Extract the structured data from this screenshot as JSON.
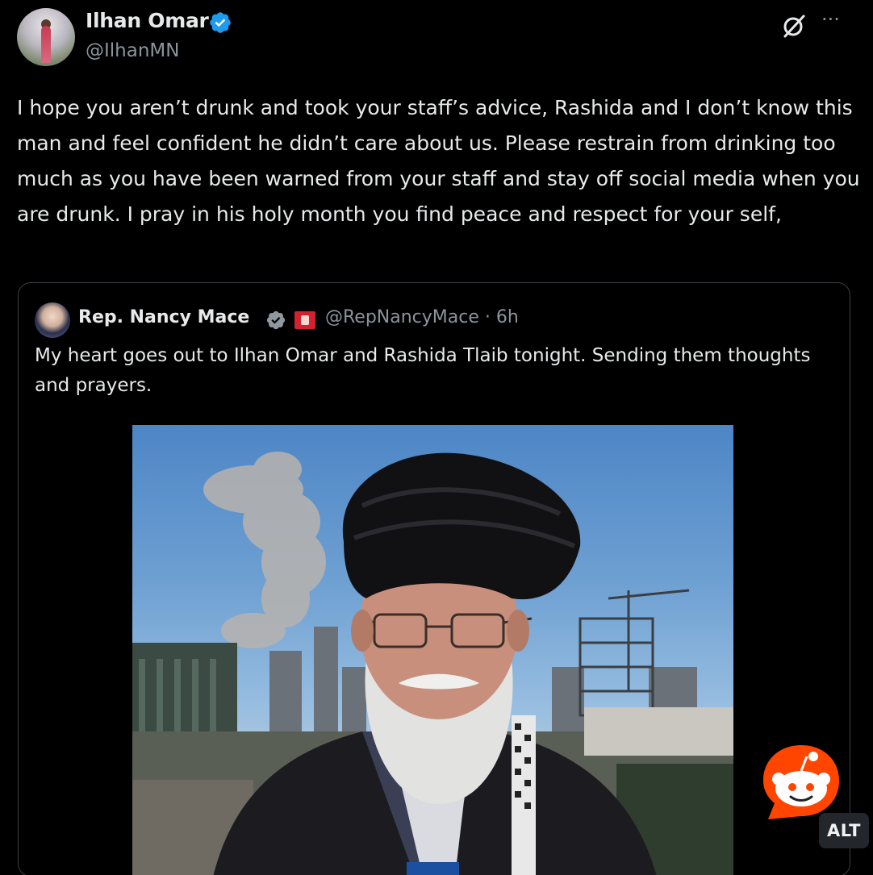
{
  "post": {
    "author": {
      "display_name": "Ilhan Omar",
      "handle": "@IlhanMN",
      "verified": true
    },
    "body": "I hope you aren’t drunk and took your staff’s advice, Rashida and I don’t know this man and feel confident he didn’t care about us. Please restrain from drinking too much as you have been warned from your staff and stay off social media when you are drunk. I pray in his holy month you find peace and respect for your self,",
    "header_icons": [
      "grok-icon",
      "more-icon"
    ],
    "more_label": "···"
  },
  "quoted_post": {
    "author": {
      "display_name": "Rep. Nancy Mace",
      "handle_time": "@RepNancyMace · 6h",
      "verified": true,
      "affiliation_badge": "house-flag-icon"
    },
    "body": "My heart goes out to Ilhan Omar and Rashida Tlaib tonight. Sending them thoughts and prayers."
  },
  "overlays": {
    "reddit_badge": "reddit-icon",
    "alt_label": "ALT"
  },
  "colors": {
    "background": "#000000",
    "text_primary": "#e7e9ea",
    "text_secondary": "#8b949b",
    "verified_blue": "#1d9bf0",
    "reddit_orange": "#ff4500",
    "border": "#3a3f44"
  }
}
